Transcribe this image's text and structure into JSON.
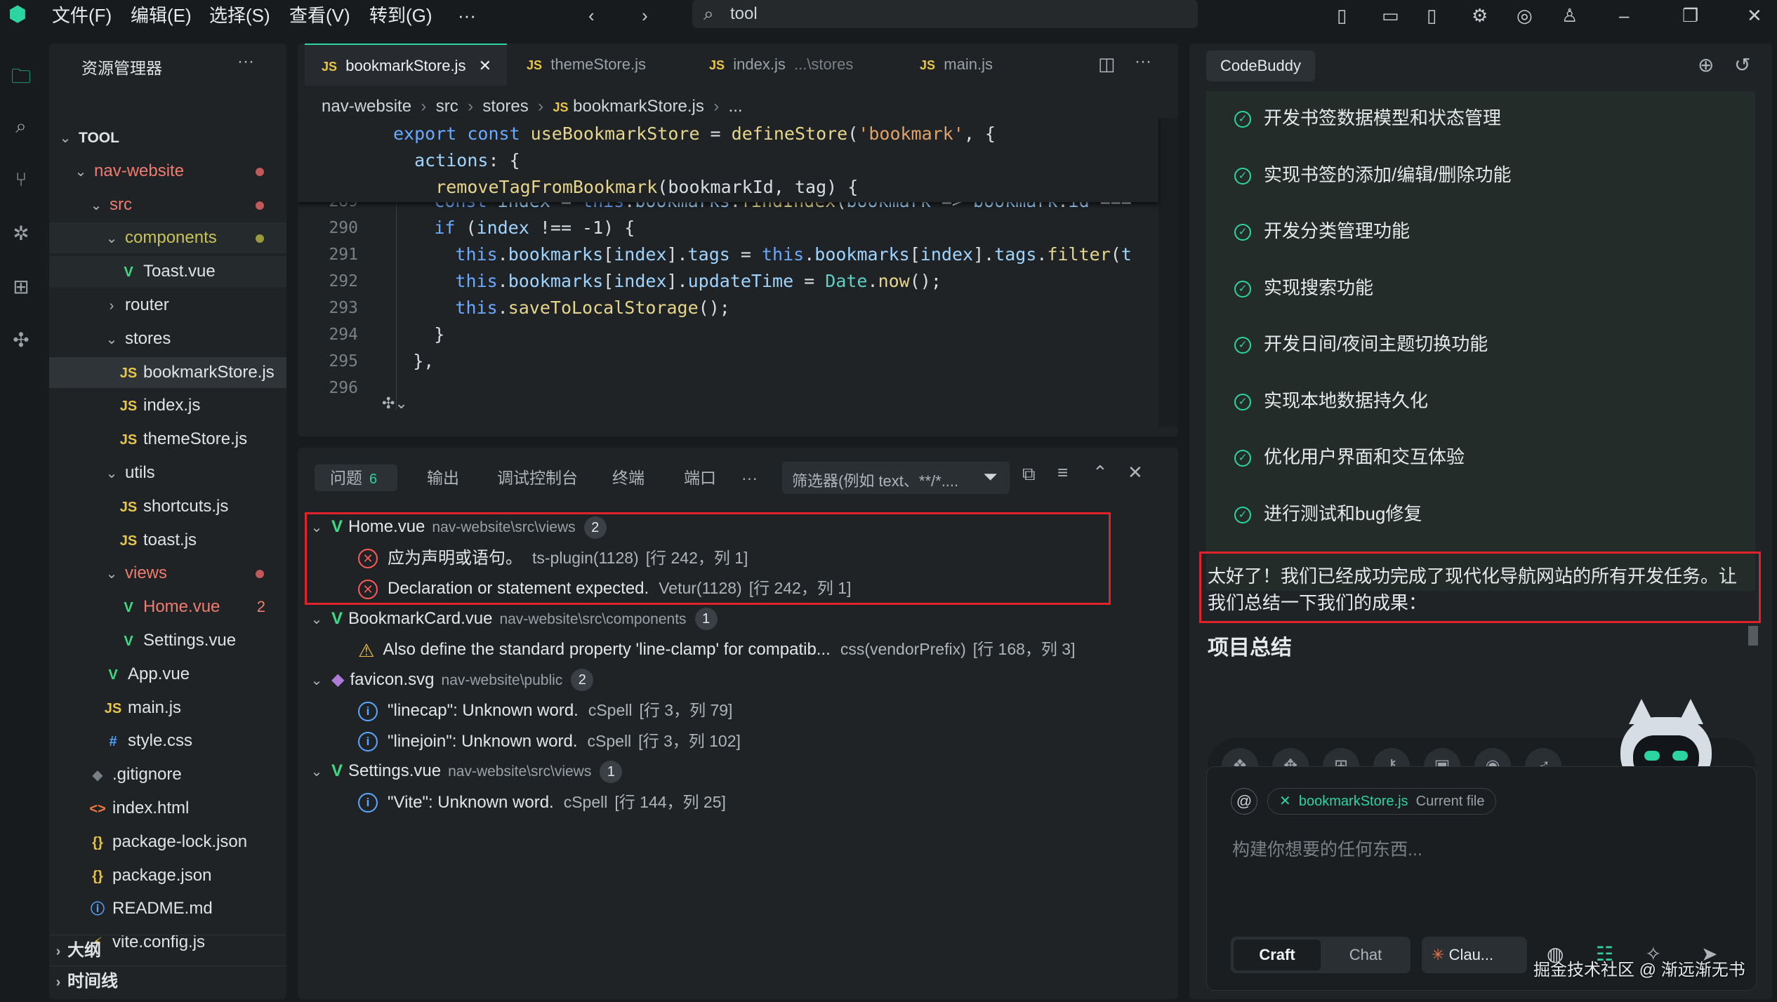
{
  "menu": [
    "文件(F)",
    "编辑(E)",
    "选择(S)",
    "查看(V)",
    "转到(G)",
    "···"
  ],
  "search": {
    "value": "tool"
  },
  "explorer": {
    "title": "资源管理器",
    "more": "···",
    "items": [
      {
        "label": "TOOL",
        "kind": "root"
      },
      {
        "label": "nav-website",
        "kind": "folder"
      },
      {
        "label": "src",
        "kind": "folder"
      },
      {
        "label": "components",
        "kind": "folder"
      },
      {
        "label": "Toast.vue",
        "kind": "vue",
        "icon": "V"
      },
      {
        "label": "router",
        "kind": "folder-closed"
      },
      {
        "label": "stores",
        "kind": "folder"
      },
      {
        "label": "bookmarkStore.js",
        "kind": "js",
        "icon": "JS"
      },
      {
        "label": "index.js",
        "kind": "js",
        "icon": "JS"
      },
      {
        "label": "themeStore.js",
        "kind": "js",
        "icon": "JS"
      },
      {
        "label": "utils",
        "kind": "folder"
      },
      {
        "label": "shortcuts.js",
        "kind": "js",
        "icon": "JS"
      },
      {
        "label": "toast.js",
        "kind": "js",
        "icon": "JS"
      },
      {
        "label": "views",
        "kind": "folder"
      },
      {
        "label": "Home.vue",
        "kind": "vue",
        "icon": "V",
        "count": "2"
      },
      {
        "label": "Settings.vue",
        "kind": "vue",
        "icon": "V"
      },
      {
        "label": "App.vue",
        "kind": "vue",
        "icon": "V"
      },
      {
        "label": "main.js",
        "kind": "js",
        "icon": "JS"
      },
      {
        "label": "style.css",
        "kind": "css",
        "icon": "#"
      },
      {
        "label": ".gitignore",
        "kind": "git",
        "icon": "◆"
      },
      {
        "label": "index.html",
        "kind": "html",
        "icon": "<>"
      },
      {
        "label": "package-lock.json",
        "kind": "json",
        "icon": "{}"
      },
      {
        "label": "package.json",
        "kind": "json",
        "icon": "{}"
      },
      {
        "label": "README.md",
        "kind": "md",
        "icon": "ⓘ"
      },
      {
        "label": "vite.config.js",
        "kind": "vite",
        "icon": "⚡"
      }
    ],
    "outline": "大纲",
    "timeline": "时间线"
  },
  "editor": {
    "tabs": [
      {
        "icon": "JS",
        "label": "bookmarkStore.js",
        "close": "✕"
      },
      {
        "icon": "JS",
        "label": "themeStore.js"
      },
      {
        "icon": "JS",
        "label": "index.js",
        "path": "...\\stores"
      },
      {
        "icon": "JS",
        "label": "main.js"
      }
    ],
    "breadcrumb": [
      "nav-website",
      "src",
      "stores",
      "bookmarkStore.js",
      "..."
    ],
    "breadcrumb_icon": "JS",
    "sticky": [
      "export const useBookmarkStore = defineStore('bookmark', {",
      "  actions: {",
      "    removeTagFromBookmark(bookmarkId, tag) {"
    ],
    "line_numbers": [
      "289",
      "290",
      "291",
      "292",
      "293",
      "294",
      "295",
      "296"
    ],
    "lines": [
      "      const index = this.bookmarks.findIndex(bookmark => bookmark.id ===",
      "      if (index !== -1) {",
      "        this.bookmarks[index].tags = this.bookmarks[index].tags.filter(t",
      "        this.bookmarks[index].updateTime = Date.now();",
      "        this.saveToLocalStorage();",
      "      }",
      "    },",
      ""
    ]
  },
  "panel": {
    "tabs": [
      "问题",
      "输出",
      "调试控制台",
      "终端",
      "端口",
      "···"
    ],
    "problems_count": "6",
    "filter_placeholder": "筛选器(例如 text、**/*....",
    "groups": [
      {
        "file": "Home.vue",
        "path": "nav-website\\src\\views",
        "count": "2",
        "icon": "V",
        "items": [
          {
            "type": "error",
            "msg": "应为声明或语句。",
            "src": "ts-plugin(1128)",
            "pos": "[行 242，列 1]"
          },
          {
            "type": "error",
            "msg": "Declaration or statement expected.",
            "src": "Vetur(1128)",
            "pos": "[行 242，列 1]"
          }
        ]
      },
      {
        "file": "BookmarkCard.vue",
        "path": "nav-website\\src\\components",
        "count": "1",
        "icon": "V",
        "items": [
          {
            "type": "warn",
            "msg": "Also define the standard property 'line-clamp' for compatib...",
            "src": "css(vendorPrefix)",
            "pos": "[行 168，列 3]"
          }
        ]
      },
      {
        "file": "favicon.svg",
        "path": "nav-website\\public",
        "count": "2",
        "icon": "◆",
        "items": [
          {
            "type": "info",
            "msg": "\"linecap\": Unknown word.",
            "src": "cSpell",
            "pos": "[行 3，列 79]"
          },
          {
            "type": "info",
            "msg": "\"linejoin\": Unknown word.",
            "src": "cSpell",
            "pos": "[行 3，列 102]"
          }
        ]
      },
      {
        "file": "Settings.vue",
        "path": "nav-website\\src\\views",
        "count": "1",
        "icon": "V",
        "items": [
          {
            "type": "info",
            "msg": "\"Vite\": Unknown word.",
            "src": "cSpell",
            "pos": "[行 144，列 25]"
          }
        ]
      }
    ]
  },
  "assistant": {
    "tab": "CodeBuddy",
    "tasks": [
      "开发书签数据模型和状态管理",
      "实现书签的添加/编辑/删除功能",
      "开发分类管理功能",
      "实现搜索功能",
      "开发日间/夜间主题切换功能",
      "实现本地数据持久化",
      "优化用户界面和交互体验",
      "进行测试和bug修复"
    ],
    "message": "太好了！我们已经成功完成了现代化导航网站的所有开发任务。让我们总结一下我们的成果：",
    "summary_title": "项目总结",
    "context_at": "@",
    "context_file": "bookmarkStore.js",
    "context_label": "Current file",
    "input_placeholder": "构建你想要的任何东西...",
    "mode_craft": "Craft",
    "mode_chat": "Chat",
    "model": "Clau...",
    "watermark": "掘金技术社区 @ 渐远渐无书"
  },
  "colors": {
    "accent": "#2bd4a0",
    "error": "#ff5a5a",
    "highlight_border": "#e0222a",
    "vue": "#3ddc84",
    "js": "#e8c547"
  }
}
